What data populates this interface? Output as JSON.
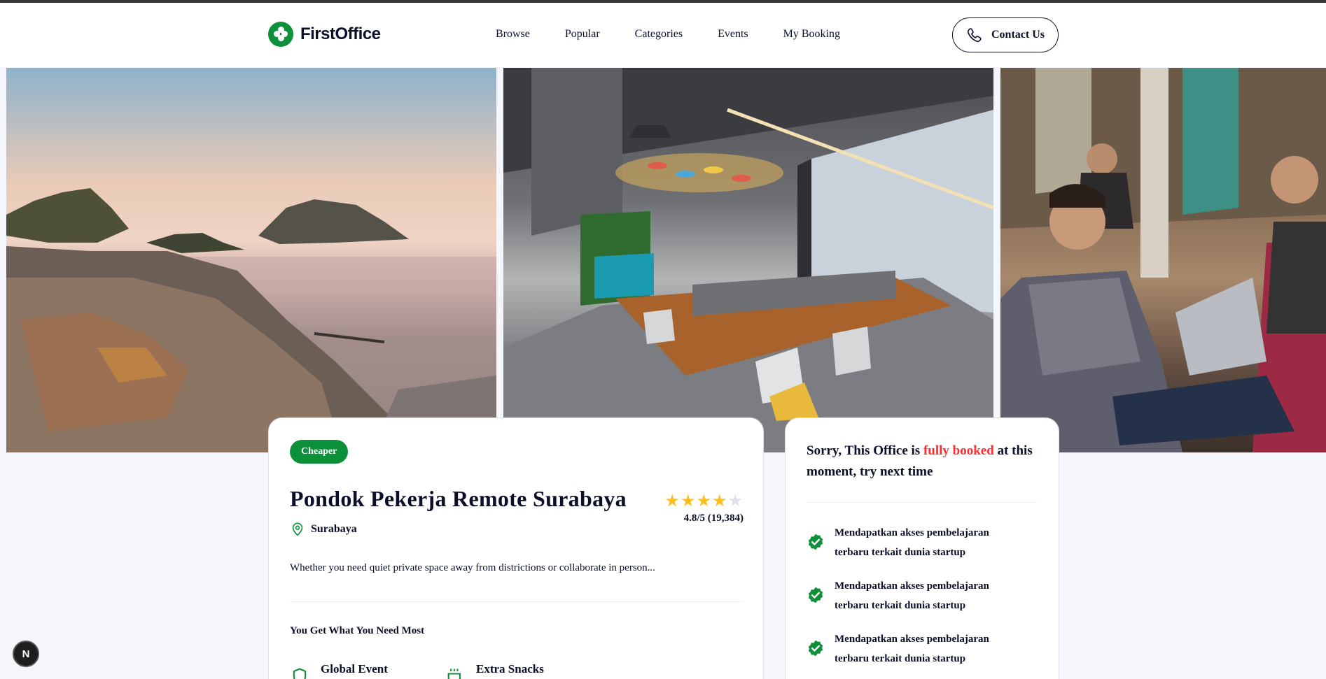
{
  "header": {
    "brand": "FirstOffice",
    "nav": [
      "Browse",
      "Popular",
      "Categories",
      "Events",
      "My Booking"
    ],
    "contact_label": "Contact Us"
  },
  "gallery": {
    "photos": [
      "coastal-city-photo",
      "open-office-photo",
      "coworking-people-photo"
    ]
  },
  "office": {
    "badge": "Cheaper",
    "title": "Pondok Pekerja Remote Surabaya",
    "location": "Surabaya",
    "rating_stars": 4,
    "rating_max": 5,
    "rating_text": "4.8/5 (19,384)",
    "description": "Whether you need quiet private space away from districtions or collaborate in person...",
    "features_title": "You Get What You Need Most",
    "features": [
      {
        "label": "Global Event",
        "icon": "shield-icon"
      },
      {
        "label": "Extra Snacks",
        "icon": "coffee-icon"
      }
    ]
  },
  "booking": {
    "message_before": "Sorry, This Office is ",
    "message_highlight": "fully booked",
    "message_after": " at this moment, try next time",
    "benefits": [
      "Mendapatkan akses pembelajaran terbaru terkait dunia startup",
      "Mendapatkan akses pembelajaran terbaru terkait dunia startup",
      "Mendapatkan akses pembelajaran terbaru terkait dunia startup"
    ]
  },
  "dev_indicator": "N",
  "colors": {
    "brand_green": "#0D903A",
    "text_dark": "#0B0F29",
    "alert_red": "#FF2D2D",
    "star_yellow": "#FFBE1D",
    "background": "#F5F6FB"
  }
}
